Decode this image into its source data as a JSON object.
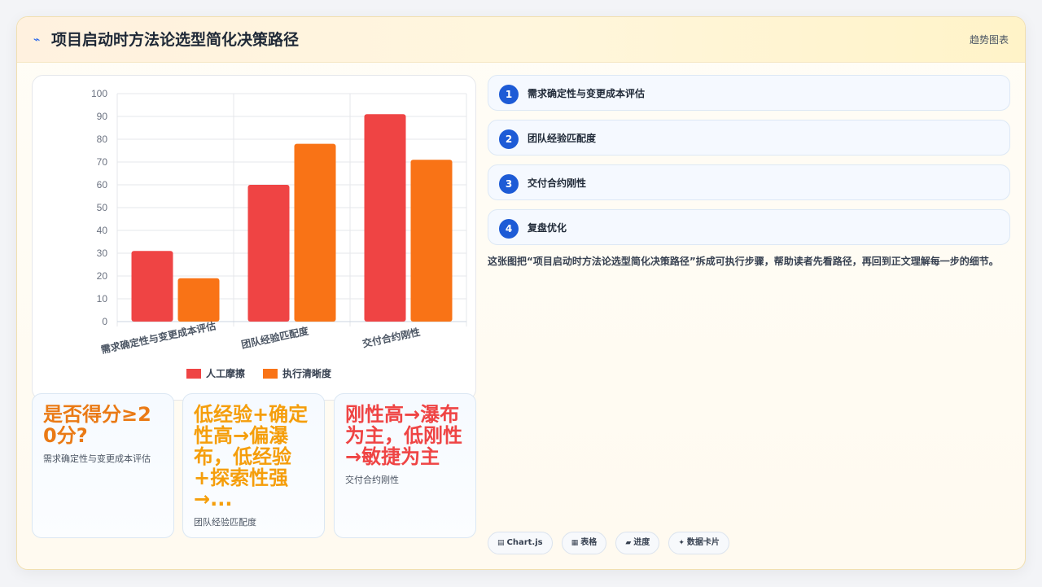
{
  "header": {
    "title": "项目启动时方法论选型简化决策路径",
    "tag": "趋势图表"
  },
  "chart_data": {
    "type": "bar",
    "categories": [
      "需求确定性与变更成本评估",
      "团队经验匹配度",
      "交付合约刚性"
    ],
    "series": [
      {
        "name": "人工摩擦",
        "color": "#ef4444",
        "values": [
          31,
          60,
          91
        ]
      },
      {
        "name": "执行清晰度",
        "color": "#f97316",
        "values": [
          19,
          78,
          71
        ]
      }
    ],
    "ylim": [
      0,
      100
    ],
    "yticks": [
      0,
      10,
      20,
      30,
      40,
      50,
      60,
      70,
      80,
      90,
      100
    ],
    "grid": true,
    "legend": "bottom"
  },
  "stats": [
    {
      "value": "是否得分≥20分?",
      "label": "需求确定性与变更成本评估",
      "color": "#ea7a15"
    },
    {
      "value": "低经验+确定性高→偏瀑布，低经验+探索性强→...",
      "label": "团队经验匹配度",
      "color": "#f59e0b"
    },
    {
      "value": "刚性高→瀑布为主，低刚性→敏捷为主",
      "label": "交付合约刚性",
      "color": "#ef4444"
    }
  ],
  "steps": [
    {
      "num": "1",
      "label": "需求确定性与变更成本评估"
    },
    {
      "num": "2",
      "label": "团队经验匹配度"
    },
    {
      "num": "3",
      "label": "交付合约刚性"
    },
    {
      "num": "4",
      "label": "复盘优化"
    }
  ],
  "description": "这张图把“项目启动时方法论选型简化决策路径”拆成可执行步骤，帮助读者先看路径，再回到正文理解每一步的细节。",
  "chips": [
    {
      "icon": "chart-icon",
      "glyph": "▤",
      "label": "Chart.js"
    },
    {
      "icon": "table-icon",
      "glyph": "▦",
      "label": "表格"
    },
    {
      "icon": "progress-icon",
      "glyph": "▰",
      "label": "进度"
    },
    {
      "icon": "sparkle-icon",
      "glyph": "✦",
      "label": "数据卡片"
    }
  ]
}
